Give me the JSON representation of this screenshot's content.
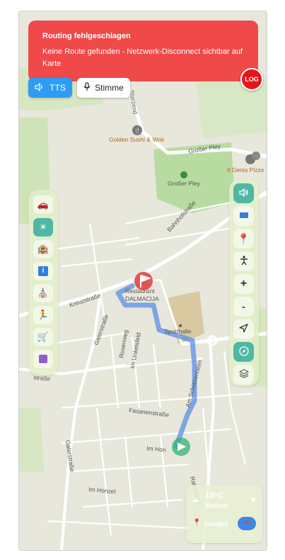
{
  "error": {
    "title": "Routing fehlgeschlagen",
    "message": "Keine Route gefunden - Netzwerk-Disconnect sichtbar auf Karte"
  },
  "log_button": "LOG",
  "audio": {
    "tts_label": "TTS",
    "voice_label": "Stimme"
  },
  "map": {
    "streets": {
      "starzend": "Starzend",
      "grosser_pley_1": "Großer Pley",
      "grosser_pley_2": "Großer Pley",
      "bahnhofstrasse": "Bahnhofstraße",
      "kreuzstrasse": "Kreuzstraße",
      "gaterstrasse": "Gaterstraße",
      "rosenweg": "Rosenweg",
      "im_unkelsfeld": "Im Unkelsfeld",
      "am_schutzenheim": "Am Schützenheim",
      "fasanenstrasse": "Fasanenstraße",
      "im_hon": "Im Hon",
      "rabenweg": "Rabenweg",
      "im_honzel": "Im Honzel",
      "gaterstrasse_2": "Gaterstraße",
      "weststrasse": "straße"
    },
    "pois": {
      "golden_sushi": "Golden Sushi & Wok",
      "il_genio": "Il Genio Pizze",
      "restaurant_1": "Restaurant",
      "restaurant_2": "DALMACIJA",
      "sporthalle": "Sporthalle"
    }
  },
  "categories": [
    "car-icon",
    "sun-icon",
    "hotel-icon",
    "info-icon",
    "church-icon",
    "running-icon",
    "cart-icon",
    "save-icon"
  ],
  "controls": [
    "speaker-icon",
    "book-icon",
    "pin-icon",
    "accessibility-icon",
    "zoom-in-icon",
    "zoom-out-icon",
    "locate-icon",
    "compass-icon",
    "layers-icon"
  ],
  "zoom": {
    "in": "+",
    "out": "-"
  },
  "weather": {
    "temperature": "18°C",
    "condition": "Wolken",
    "mode": "Gangelt"
  },
  "colors": {
    "error": "#ef4949",
    "tts": "#2f9cf4",
    "route": "#5b8fe6",
    "accent_teal": "#4fb7a4",
    "destination": "#e03a3a"
  }
}
